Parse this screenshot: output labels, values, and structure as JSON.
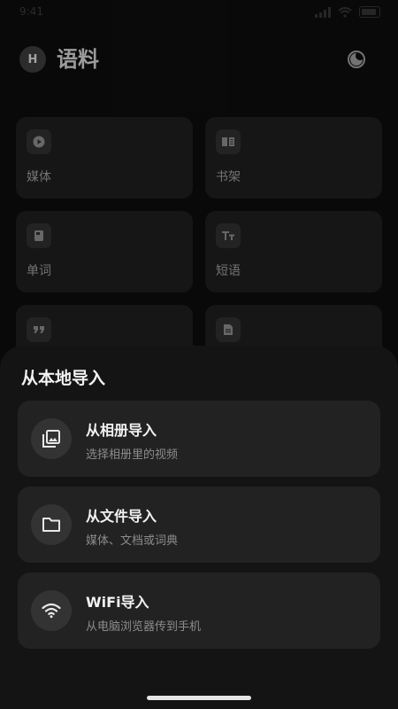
{
  "status": {
    "time": "9:41"
  },
  "header": {
    "avatar_letter": "H",
    "title": "语料"
  },
  "grid": {
    "items": [
      {
        "label": "媒体",
        "icon": "play-icon"
      },
      {
        "label": "书架",
        "icon": "book-icon"
      },
      {
        "label": "单词",
        "icon": "notebook-icon"
      },
      {
        "label": "短语",
        "icon": "text-size-icon"
      },
      {
        "label": "",
        "icon": "quote-icon"
      },
      {
        "label": "",
        "icon": "document-icon"
      }
    ]
  },
  "sheet": {
    "title": "从本地导入",
    "options": [
      {
        "title": "从相册导入",
        "subtitle": "选择相册里的视频",
        "icon": "photo-library-icon"
      },
      {
        "title": "从文件导入",
        "subtitle": "媒体、文档或词典",
        "icon": "folder-icon"
      },
      {
        "title": "WiFi导入",
        "subtitle": "从电脑浏览器传到手机",
        "icon": "wifi-icon"
      }
    ]
  }
}
